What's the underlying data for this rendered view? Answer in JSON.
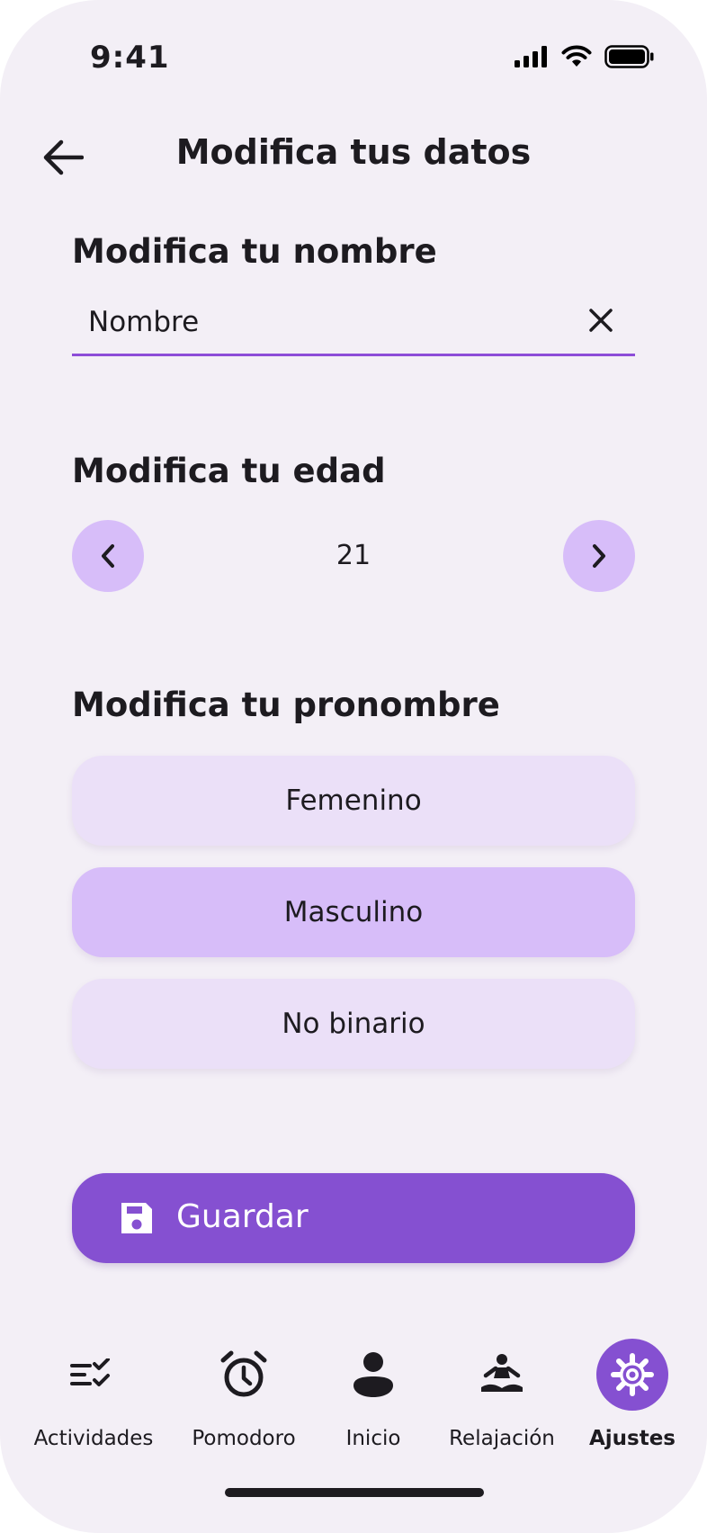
{
  "status_bar": {
    "time": "9:41"
  },
  "header": {
    "title": "Modifica tus datos"
  },
  "name_section": {
    "title": "Modifica tu nombre",
    "value": "Nombre"
  },
  "age_section": {
    "title": "Modifica tu edad",
    "value": "21"
  },
  "pronoun_section": {
    "title": "Modifica tu pronombre",
    "options": [
      {
        "label": "Femenino",
        "selected": false
      },
      {
        "label": "Masculino",
        "selected": true
      },
      {
        "label": "No binario",
        "selected": false
      }
    ]
  },
  "save_button": {
    "label": "Guardar",
    "icon": "save-icon"
  },
  "bottom_nav": {
    "items": [
      {
        "label": "Actividades",
        "icon": "checklist-icon",
        "active": false
      },
      {
        "label": "Pomodoro",
        "icon": "alarm-clock-icon",
        "active": false
      },
      {
        "label": "Inicio",
        "icon": "person-icon",
        "active": false
      },
      {
        "label": "Relajación",
        "icon": "meditation-icon",
        "active": false
      },
      {
        "label": "Ajustes",
        "icon": "gear-icon",
        "active": true
      }
    ]
  },
  "colors": {
    "background": "#f3eff6",
    "accent": "#8550d1",
    "selected_option": "#d7bdf9",
    "unselected_option": "#ebe0f8",
    "text": "#1d1b20"
  }
}
